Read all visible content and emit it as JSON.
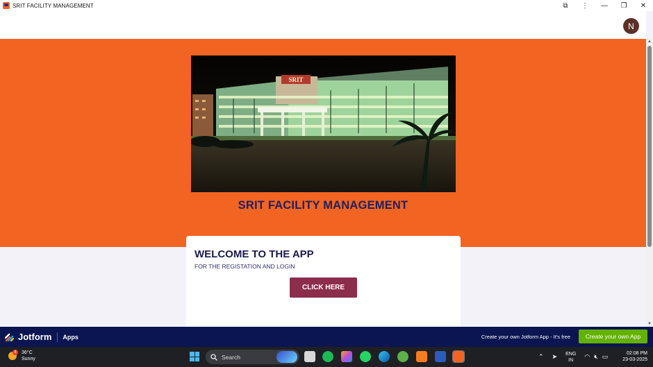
{
  "window": {
    "title": "SRIT FACILITY MANAGEMENT",
    "controls": {
      "extensions": "⧉",
      "more": "⋮",
      "minimize": "—",
      "maximize": "❐",
      "close": "✕"
    }
  },
  "header": {
    "avatar_initial": "N"
  },
  "hero": {
    "image_sign": "SRIT",
    "title": "SRIT FACILITY MANAGEMENT"
  },
  "card": {
    "title": "WELCOME TO THE APP",
    "subtitle": "FOR THE REGISTATION AND LOGIN",
    "button_label": "CLICK HERE"
  },
  "jotform_bar": {
    "brand": "Jotform",
    "section": "Apps",
    "promo_text": "Create your own Jotform App - It's free",
    "cta_label": "Create your own App"
  },
  "taskbar": {
    "weather": {
      "temperature": "36°C",
      "condition": "Sunny",
      "badge": "8"
    },
    "search_label": "Search",
    "apps": [
      "file-explorer",
      "spotify",
      "copilot",
      "whatsapp",
      "edge",
      "git",
      "xampp",
      "word",
      "srit-app"
    ],
    "tray": {
      "language": "ENG",
      "region": "IN"
    },
    "clock": {
      "time": "02:08 PM",
      "date": "23-03-2025"
    }
  },
  "colors": {
    "hero_orange": "#f26422",
    "title_navy": "#1f2160",
    "button_maroon": "#8c2d4c",
    "jotform_navy": "#0a1551",
    "cta_green": "#64b200"
  }
}
